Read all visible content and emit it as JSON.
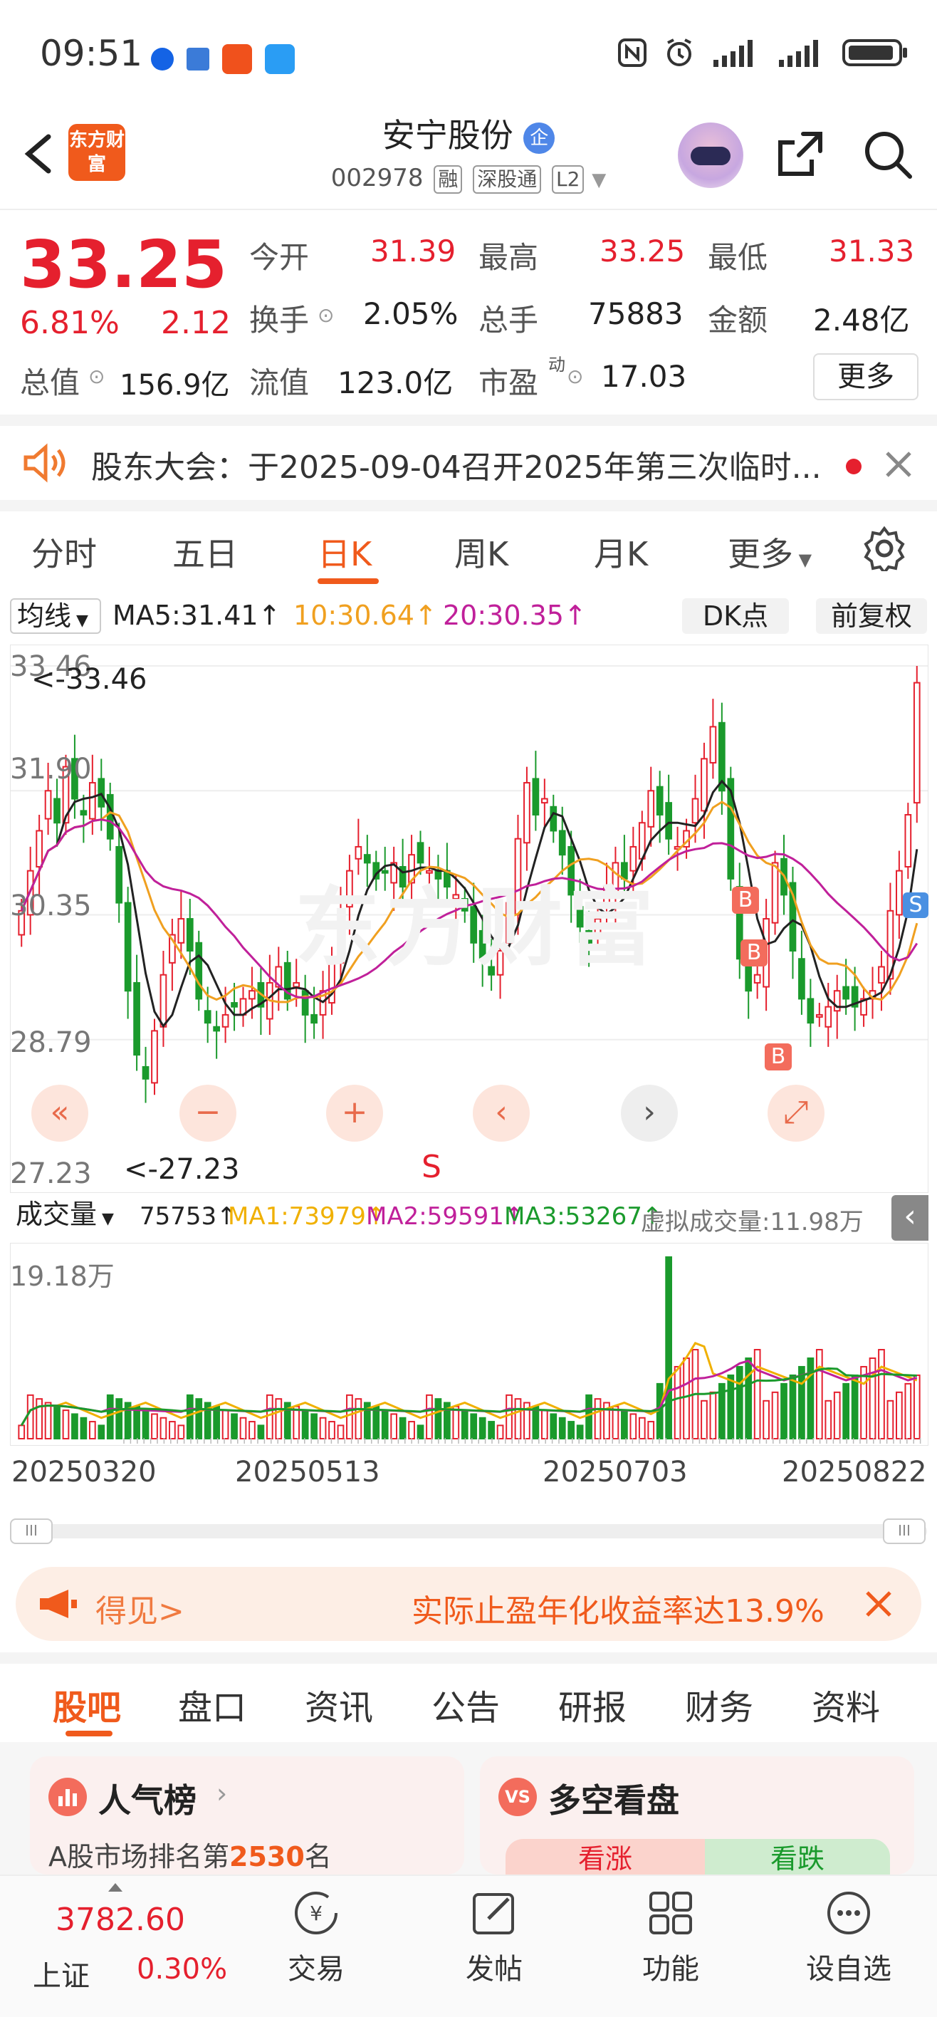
{
  "status_bar": {
    "time": "09:51"
  },
  "header": {
    "logo_text": "东方财富",
    "title": "安宁股份",
    "title_badge": "企",
    "code": "002978",
    "tags": [
      "融",
      "深股通",
      "L2"
    ]
  },
  "quote": {
    "price": "33.25",
    "change_pct": "6.81%",
    "change": "2.12",
    "open_label": "今开",
    "open": "31.39",
    "high_label": "最高",
    "high": "33.25",
    "low_label": "最低",
    "low": "31.33",
    "turnover_label": "换手",
    "turnover": "2.05%",
    "volume_label": "总手",
    "volume": "75883",
    "amount_label": "金额",
    "amount": "2.48亿",
    "mcap_label": "总值",
    "mcap": "156.9亿",
    "float_label": "流值",
    "float": "123.0亿",
    "pe_label": "市盈",
    "pe_sup": "动",
    "pe": "17.03",
    "more": "更多"
  },
  "notice": {
    "text": "股东大会：于2025-09-04召开2025年第三次临时..."
  },
  "kline_tabs": [
    "分时",
    "五日",
    "日K",
    "周K",
    "月K",
    "更多"
  ],
  "kline_active": "日K",
  "chart_toolbar": {
    "ma_select": "均线",
    "ma5": "MA5:31.41↑",
    "ma10": "10:30.64↑",
    "ma20": "20:30.35↑",
    "dk": "DK点",
    "adjust": "前复权"
  },
  "chart_labels": {
    "y_top": "33.46",
    "y_2": "31.90",
    "y_mid": "30.35",
    "y_4": "28.79",
    "y_bot": "27.23",
    "max_note": "<-33.46",
    "min_note": "<-27.23",
    "s_mark": "S",
    "b_mark": "B",
    "watermark": "东方财富"
  },
  "volume_toolbar": {
    "select": "成交量",
    "vol": "75753↑",
    "ma1": "MA1:73979↑",
    "ma2": "MA2:59591↑",
    "ma3": "MA3:53267↑",
    "virtual": "虚拟成交量:11.98万",
    "y_top": "19.18万"
  },
  "x_dates": [
    "20250320",
    "20250513",
    "20250703",
    "20250822"
  ],
  "promo": {
    "left": "得见>",
    "right": "实际止盈年化收益率达13.9%"
  },
  "sub_tabs": [
    "股吧",
    "盘口",
    "资讯",
    "公告",
    "研报",
    "财务",
    "资料"
  ],
  "sub_active": "股吧",
  "cards": {
    "left_title": "人气榜",
    "left_text_prefix": "A股市场排名第",
    "left_rank": "2530",
    "left_text_suffix": "名",
    "right_title": "多空看盘",
    "right_up": "看涨",
    "right_down": "看跌"
  },
  "bottom_nav": {
    "index_value": "3782.60",
    "index_name": "上证",
    "index_change": "0.30%",
    "items": [
      "交易",
      "发帖",
      "功能",
      "设自选"
    ]
  },
  "colors": {
    "up": "#e5202e",
    "down": "#1a9a2c",
    "ma5": "#222222",
    "ma10": "#f0a020",
    "ma20": "#c0209a"
  },
  "chart_data": {
    "type": "candlestick",
    "ylim": [
      27.23,
      33.46
    ],
    "x_labels": [
      "20250320",
      "20250513",
      "20250703",
      "20250822"
    ],
    "close": [
      30.4,
      30.9,
      31.4,
      31.9,
      31.5,
      32.2,
      31.8,
      31.6,
      32.0,
      31.7,
      31.3,
      30.5,
      29.4,
      28.6,
      28.3,
      28.9,
      29.6,
      30.1,
      30.3,
      29.9,
      29.3,
      29.0,
      28.9,
      29.1,
      29.2,
      29.3,
      29.4,
      29.2,
      29.5,
      29.7,
      29.3,
      29.5,
      29.1,
      29.0,
      29.4,
      29.8,
      30.4,
      30.9,
      31.2,
      31.0,
      30.8,
      30.9,
      31.0,
      30.7,
      31.1,
      31.0,
      30.9,
      30.8,
      30.7,
      30.6,
      30.4,
      30.0,
      29.8,
      29.6,
      29.9,
      30.5,
      31.3,
      32.0,
      31.6,
      31.8,
      31.4,
      31.1,
      30.6,
      30.2,
      30.0,
      30.3,
      30.7,
      31.0,
      30.8,
      31.2,
      31.5,
      31.9,
      31.6,
      31.3,
      31.2,
      31.4,
      31.8,
      32.3,
      32.7,
      31.9,
      30.8,
      29.8,
      29.4,
      29.6,
      30.3,
      31.0,
      30.6,
      29.9,
      29.3,
      29.0,
      29.1,
      29.2,
      29.4,
      29.3,
      29.2,
      29.3,
      29.4,
      29.7,
      30.4,
      30.9,
      31.6,
      33.25
    ],
    "ma5_note": "MA5 31.41",
    "volume_ylim": [
      0,
      191800
    ]
  }
}
